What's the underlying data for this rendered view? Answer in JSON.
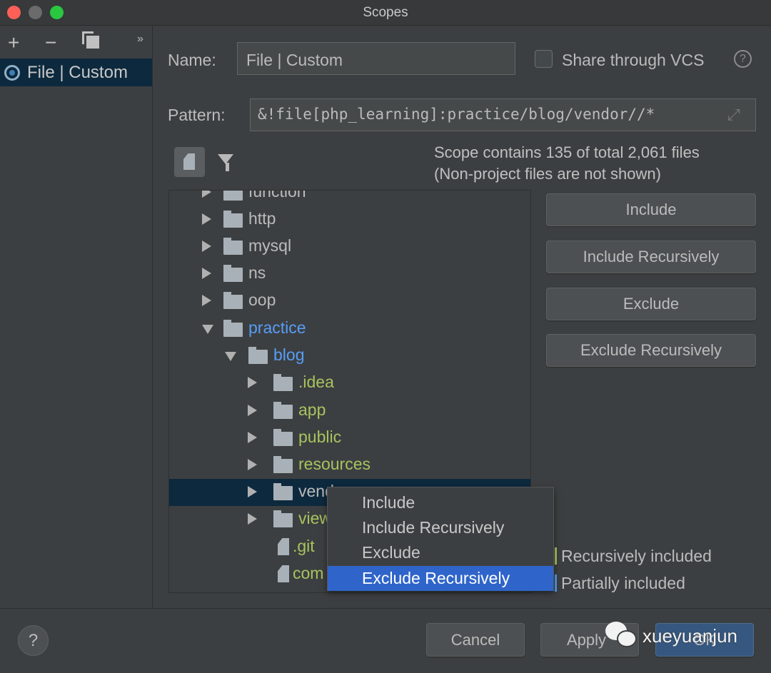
{
  "window": {
    "title": "Scopes",
    "colors": {
      "close": "#fe5f57",
      "minimize": "#6b6b6b",
      "zoom": "#29c840"
    }
  },
  "sidebar": {
    "toolbar": {
      "add": "+",
      "remove": "−",
      "more": "»"
    },
    "items": [
      {
        "label": "File | Custom",
        "selected": true
      }
    ]
  },
  "form": {
    "name_label": "Name:",
    "name_value": "File | Custom",
    "share_label": "Share through VCS",
    "share_checked": false,
    "pattern_label": "Pattern:",
    "pattern_value": "&!file[php_learning]:practice/blog/vendor//*"
  },
  "scope_info": {
    "line1": "Scope contains 135 of total 2,061 files",
    "line2": "(Non-project files are not shown)"
  },
  "tree": [
    {
      "label": "function",
      "level": 0,
      "type": "folder",
      "expanded": false,
      "color": "normal"
    },
    {
      "label": "http",
      "level": 0,
      "type": "folder",
      "expanded": false,
      "color": "normal"
    },
    {
      "label": "mysql",
      "level": 0,
      "type": "folder",
      "expanded": false,
      "color": "normal"
    },
    {
      "label": "ns",
      "level": 0,
      "type": "folder",
      "expanded": false,
      "color": "normal"
    },
    {
      "label": "oop",
      "level": 0,
      "type": "folder",
      "expanded": false,
      "color": "normal"
    },
    {
      "label": "practice",
      "level": 0,
      "type": "folder",
      "expanded": true,
      "color": "blue"
    },
    {
      "label": "blog",
      "level": 1,
      "type": "folder",
      "expanded": true,
      "color": "blue"
    },
    {
      "label": ".idea",
      "level": 2,
      "type": "folder",
      "expanded": false,
      "color": "green"
    },
    {
      "label": "app",
      "level": 2,
      "type": "folder",
      "expanded": false,
      "color": "green"
    },
    {
      "label": "public",
      "level": 2,
      "type": "folder",
      "expanded": false,
      "color": "green"
    },
    {
      "label": "resources",
      "level": 2,
      "type": "folder",
      "expanded": false,
      "color": "green"
    },
    {
      "label": "vendor",
      "level": 2,
      "type": "folder",
      "expanded": false,
      "color": "normal",
      "selected": true
    },
    {
      "label": "views",
      "level": 2,
      "type": "folder",
      "expanded": false,
      "color": "green"
    },
    {
      "label": ".git",
      "level": 2,
      "type": "file",
      "color": "green"
    },
    {
      "label": "com",
      "level": 2,
      "type": "file",
      "color": "green"
    }
  ],
  "actions": [
    "Include",
    "Include Recursively",
    "Exclude",
    "Exclude Recursively"
  ],
  "context_menu": {
    "items": [
      "Include",
      "Include Recursively",
      "Exclude",
      "Exclude Recursively"
    ],
    "selected_index": 3
  },
  "legend": [
    {
      "label": "Recursively included",
      "color": "#a8c35e"
    },
    {
      "label": "Partially included",
      "color": "#589df6"
    }
  ],
  "footer": {
    "help": "?",
    "cancel": "Cancel",
    "apply": "Apply",
    "ok": "OK"
  },
  "watermark": "xueyuanjun"
}
